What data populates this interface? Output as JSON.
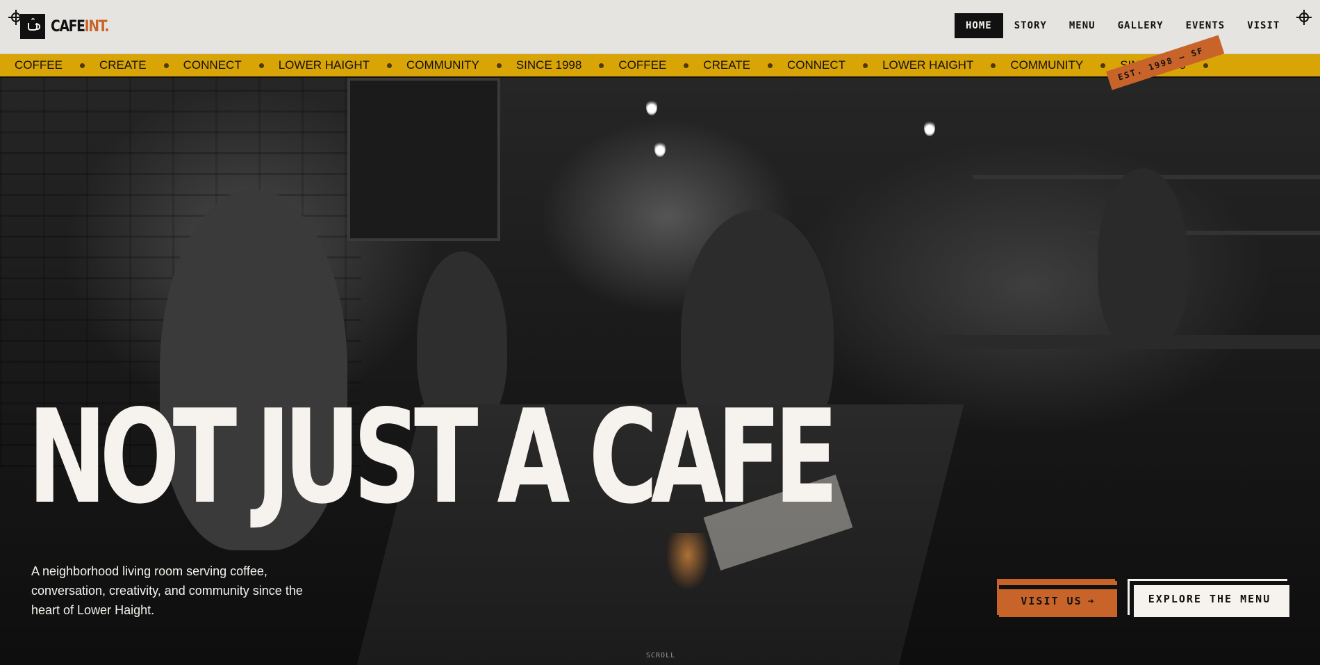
{
  "brand": {
    "logo_part1": "CAFE",
    "logo_part2": "INT.",
    "accent": "#c8642a",
    "ticker_color": "#d9a406"
  },
  "nav": {
    "items": [
      {
        "label": "HOME",
        "active": true
      },
      {
        "label": "STORY"
      },
      {
        "label": "MENU"
      },
      {
        "label": "GALLERY"
      },
      {
        "label": "EVENTS"
      },
      {
        "label": "VISIT"
      }
    ]
  },
  "ticker": {
    "words": [
      "COFFEE",
      "CREATE",
      "CONNECT",
      "LOWER HAIGHT",
      "COMMUNITY",
      "SINCE 1998",
      "COFFEE",
      "CREATE",
      "CONNECT",
      "LOWER HAIGHT",
      "COMMUNITY",
      "SINCE 1998"
    ]
  },
  "hero": {
    "badge": "EST. 1998 — SF",
    "headline": "NOT JUST A CAFE",
    "subtext": "A neighborhood living room serving coffee, conversation, creativity, and community since the heart of Lower Haight.",
    "visit_button": "VISIT US",
    "menu_button": "EXPLORE THE MENU",
    "scroll_label": "SCROLL"
  },
  "icons": {
    "logo": "coffee-cup-icon",
    "crosshair": "crosshair-icon",
    "arrow": "arrow-right-icon"
  }
}
